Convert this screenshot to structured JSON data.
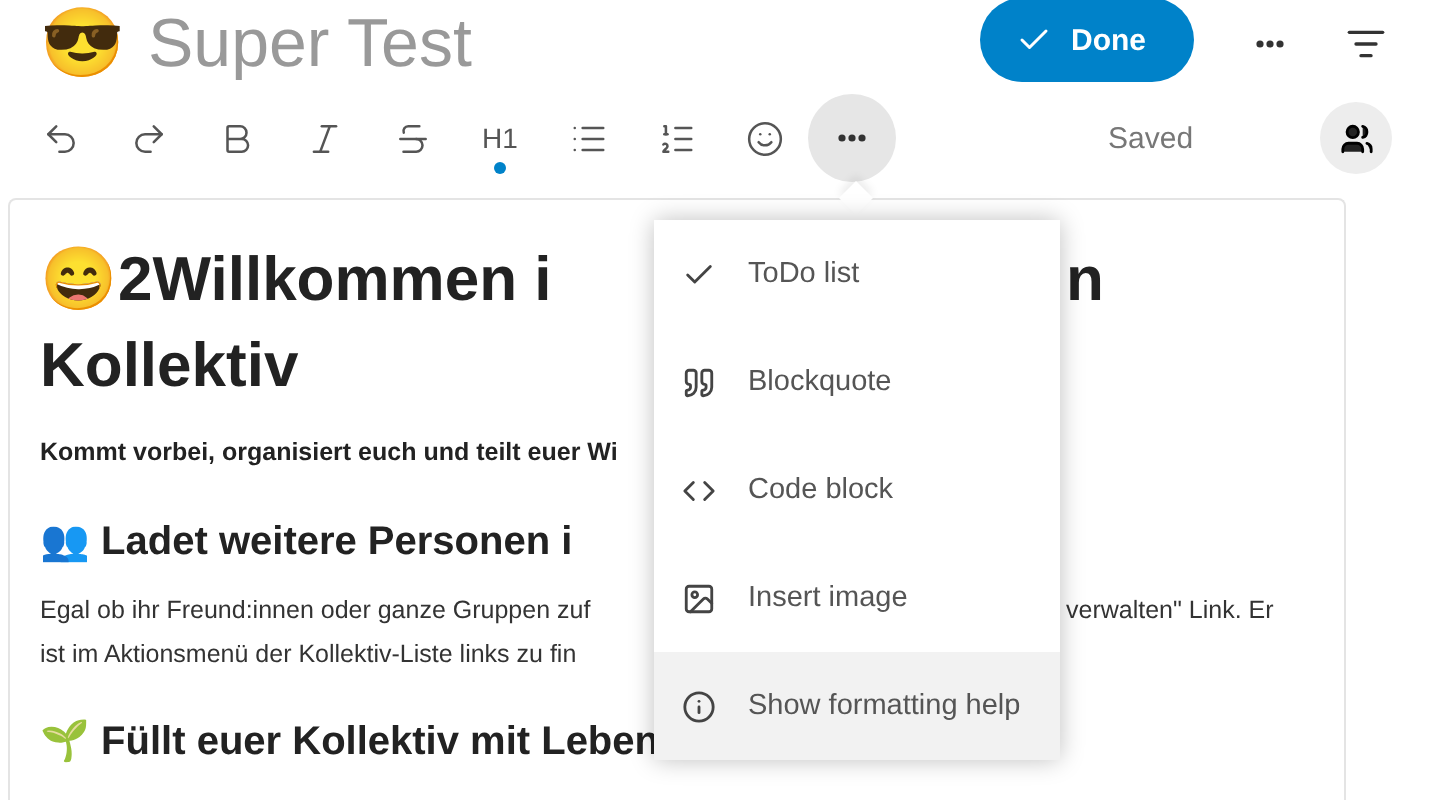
{
  "header": {
    "emoji": "😎",
    "title": "Super Test",
    "done_button": {
      "label": "Done"
    }
  },
  "toolbar": {
    "items": [
      {
        "kind": "undo",
        "active": false
      },
      {
        "kind": "redo",
        "active": false
      },
      {
        "kind": "bold",
        "active": false
      },
      {
        "kind": "italic",
        "active": false
      },
      {
        "kind": "strike",
        "active": false
      },
      {
        "kind": "heading",
        "label": "H1",
        "active": true
      },
      {
        "kind": "bullets",
        "active": false
      },
      {
        "kind": "numbered",
        "active": false
      },
      {
        "kind": "emoji",
        "active": false
      }
    ],
    "more_button": {
      "open": true
    },
    "status": "Saved"
  },
  "menu": {
    "items": [
      {
        "kind": "todo",
        "label": "ToDo list",
        "highlighted": false
      },
      {
        "kind": "quote",
        "label": "Blockquote",
        "highlighted": false
      },
      {
        "kind": "code",
        "label": "Code block",
        "highlighted": false
      },
      {
        "kind": "image",
        "label": "Insert image",
        "highlighted": false
      },
      {
        "kind": "info",
        "label": "Show formatting help",
        "highlighted": true
      }
    ]
  },
  "document": {
    "blocks": [
      {
        "kind": "h1",
        "lines": [
          [
            "😄2Willkommen i",
            "n"
          ],
          [
            "Kollektiv"
          ]
        ]
      },
      {
        "kind": "lead",
        "lines": [
          [
            "Kommt vorbei, organisiert euch und teilt euer Wi"
          ]
        ]
      },
      {
        "kind": "h2",
        "lines": [
          [
            "👥 Ladet weitere Personen i"
          ]
        ]
      },
      {
        "kind": "p",
        "lines": [
          [
            "Egal ob ihr Freund:innen oder ganze Gruppen zuf",
            "verwalten\" Link. Er"
          ],
          [
            "ist im Aktionsmenü der Kollektiv-Liste links zu fin"
          ]
        ]
      },
      {
        "kind": "h2",
        "lines": [
          [
            "🌱 Füllt euer Kollektiv mit Leben"
          ]
        ]
      }
    ]
  }
}
